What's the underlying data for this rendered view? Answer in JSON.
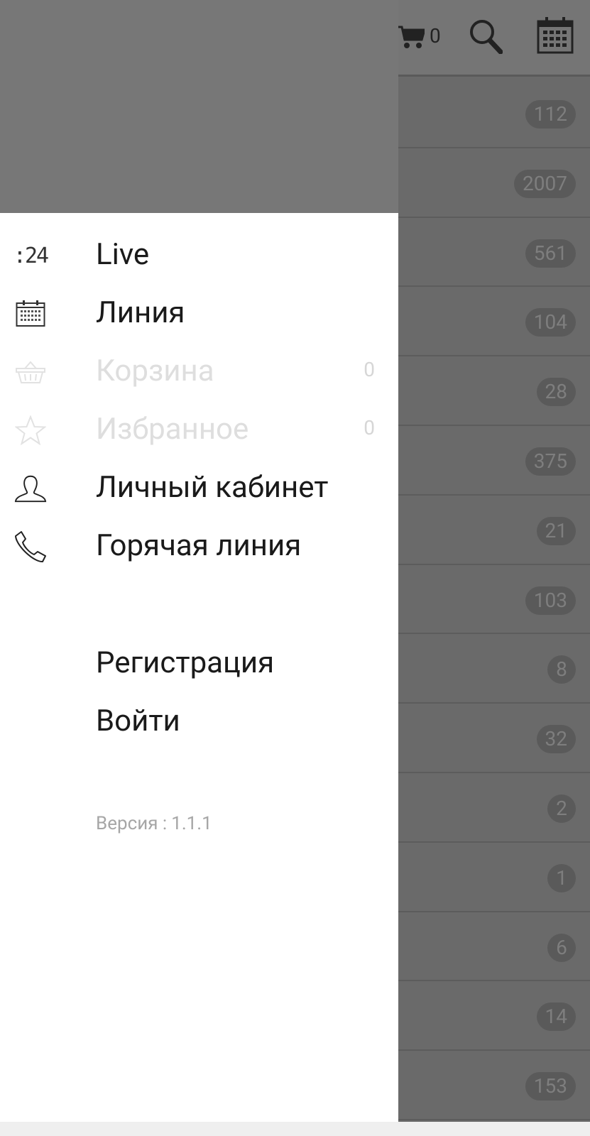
{
  "app": {
    "toolbar": {
      "cart_count": "0",
      "icons": [
        "cart-icon",
        "search-icon",
        "calendar-icon"
      ]
    },
    "rows": [
      {
        "count": "112"
      },
      {
        "count": "2007"
      },
      {
        "count": "561"
      },
      {
        "count": "104"
      },
      {
        "count": "28"
      },
      {
        "count": "375"
      },
      {
        "count": "21"
      },
      {
        "count": "103"
      },
      {
        "count": "8"
      },
      {
        "count": "32"
      },
      {
        "count": "2"
      },
      {
        "count": "1"
      },
      {
        "count": "6"
      },
      {
        "count": "14"
      },
      {
        "count": "153"
      }
    ]
  },
  "drawer": {
    "menu": [
      {
        "label": "Live",
        "icon": "live-24-icon",
        "icon_text": ":24",
        "enabled": true
      },
      {
        "label": "Линия",
        "icon": "calendar-icon",
        "enabled": true
      },
      {
        "label": "Корзина",
        "icon": "basket-icon",
        "enabled": false,
        "count": "0"
      },
      {
        "label": "Избранное",
        "icon": "star-icon",
        "enabled": false,
        "count": "0"
      },
      {
        "label": "Личный кабинет",
        "icon": "user-icon",
        "enabled": true
      },
      {
        "label": "Горячая линия",
        "icon": "phone-icon",
        "enabled": true
      }
    ],
    "auth": {
      "register_label": "Регистрация",
      "login_label": "Войти"
    },
    "version": {
      "label": "Версия :",
      "value": "1.1.1"
    }
  },
  "colors": {
    "drawer_bg": "#ffffff",
    "header_bg": "#777777",
    "scrim_bg": "#6a6a6a",
    "text_primary": "#1a1a1a",
    "text_disabled": "#dedede",
    "text_secondary": "#a6a6a6"
  }
}
